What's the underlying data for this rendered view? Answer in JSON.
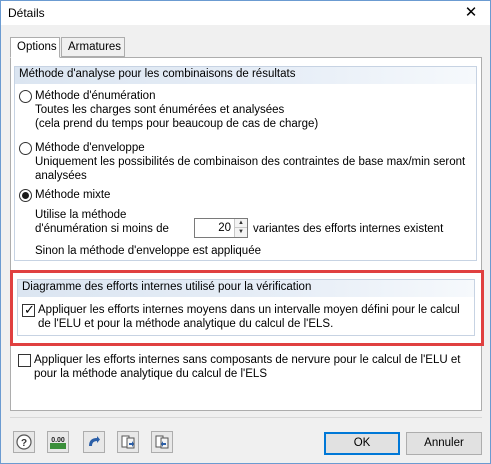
{
  "window": {
    "title": "Détails"
  },
  "tabs": [
    {
      "label": "Options",
      "active": true
    },
    {
      "label": "Armatures",
      "active": false
    }
  ],
  "analysis_group": {
    "header": "Méthode d'analyse pour les combinaisons de résultats",
    "options": [
      {
        "label": "Méthode d'énumération",
        "selected": false,
        "description": [
          "Toutes les charges sont énumérées et analysées",
          "(cela prend du temps pour beaucoup de cas de charge)"
        ]
      },
      {
        "label": "Méthode d'enveloppe",
        "selected": false,
        "description": [
          "Uniquement les possibilités de combinaison des contraintes de base max/min seront",
          "analysées"
        ]
      },
      {
        "label": "Méthode mixte",
        "selected": true,
        "description": []
      }
    ],
    "mixed": {
      "line1": "Utilise la méthode",
      "line2": "d'énumération si moins de",
      "value": "20",
      "suffix": "variantes des efforts internes existent",
      "note": "Sinon la méthode d'enveloppe est appliquée"
    }
  },
  "diagram_group": {
    "header": "Diagramme des efforts internes utilisé pour la vérification",
    "checkbox": {
      "checked": true,
      "lines": [
        "Appliquer les efforts internes moyens dans un intervalle moyen défini pour le calcul",
        "de l'ELU et pour la méthode analytique du calcul de l'ELS."
      ]
    }
  },
  "rib_checkbox": {
    "checked": false,
    "lines": [
      "Appliquer les efforts internes sans composants de nervure pour le calcul de l'ELU et",
      "pour la méthode analytique du calcul de l'ELS"
    ]
  },
  "toolbar": {
    "icons": [
      "help-icon",
      "units-icon",
      "reset-icon",
      "import-icon",
      "export-icon"
    ],
    "units_text": "0.00"
  },
  "buttons": {
    "ok": "OK",
    "cancel": "Annuler"
  },
  "colors": {
    "highlight": "#e04040",
    "group_header": "#dbe5f1",
    "default_button": "#0078d7"
  }
}
